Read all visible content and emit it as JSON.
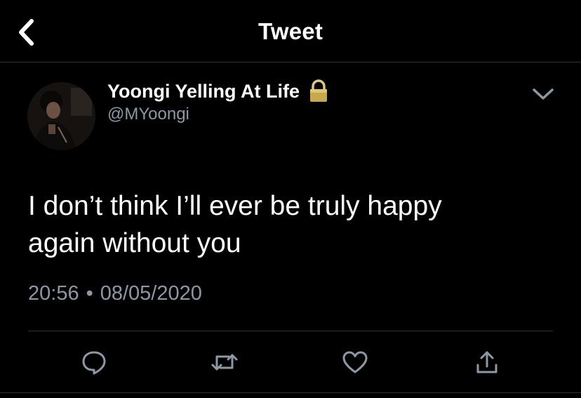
{
  "header": {
    "title": "Tweet",
    "back_icon": "chevron-left-icon"
  },
  "tweet": {
    "author_name": "Yoongi Yelling At Life",
    "author_handle": "@MYoongi",
    "protected_icon": "lock-icon",
    "text_line1": "I don’t think I’ll ever be truly happy",
    "text_line2": "again without you",
    "time": "20:56",
    "separator": "•",
    "date": "08/05/2020",
    "menu_icon": "chevron-down-icon"
  },
  "actions": [
    {
      "name": "reply",
      "icon": "speech-bubble-icon"
    },
    {
      "name": "retweet",
      "icon": "retweet-icon"
    },
    {
      "name": "like",
      "icon": "heart-icon"
    },
    {
      "name": "share",
      "icon": "share-icon"
    }
  ],
  "colors": {
    "background": "#000000",
    "text": "#ffffff",
    "secondary_text": "#8b98a5",
    "divider": "#2f3336",
    "lock": "#c9a94e"
  }
}
